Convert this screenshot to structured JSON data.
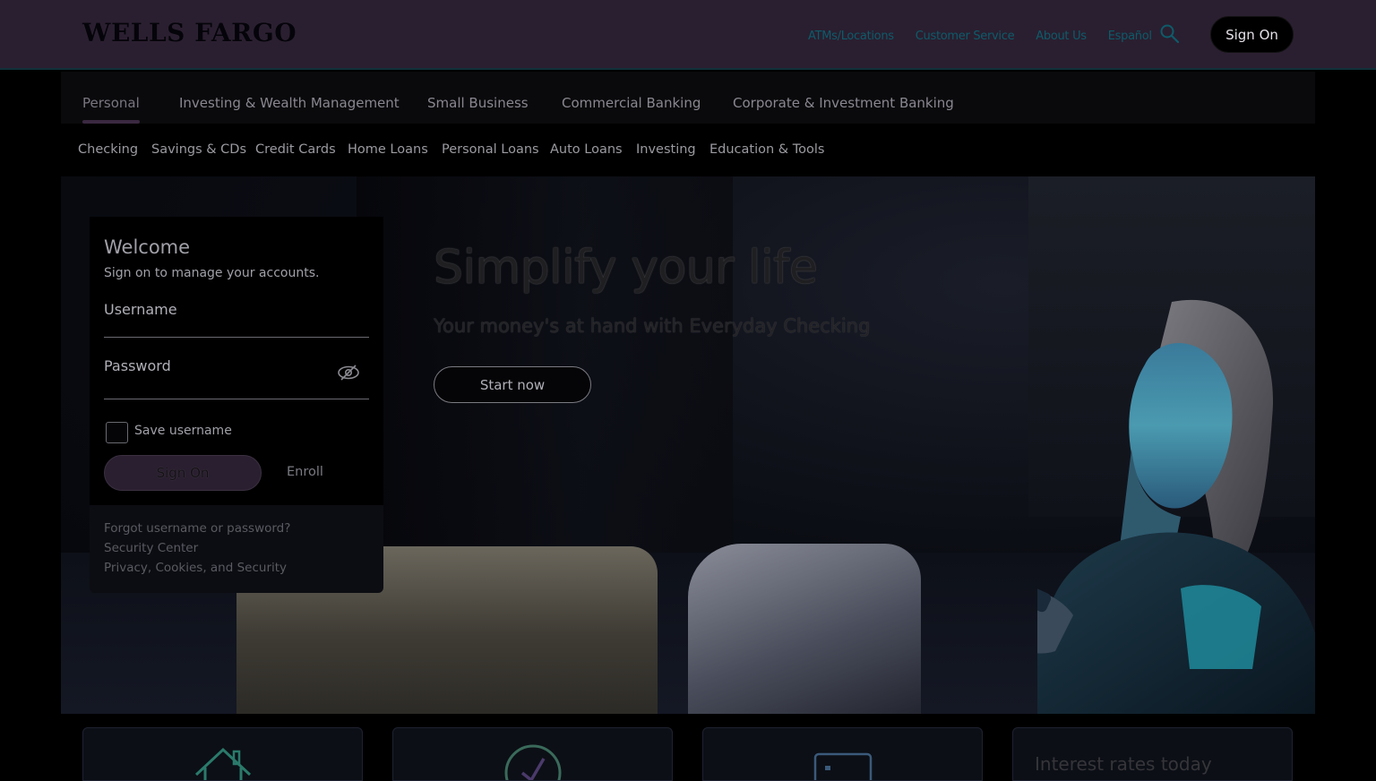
{
  "header": {
    "logo": "WELLS FARGO",
    "links": [
      "ATMs/Locations",
      "Customer Service",
      "About Us",
      "Español"
    ],
    "sign_on": "Sign On",
    "search_icon": "search-icon"
  },
  "main_nav": {
    "tabs": [
      "Personal",
      "Investing & Wealth Management",
      "Small Business",
      "Commercial Banking",
      "Corporate & Investment Banking"
    ],
    "active": "Personal"
  },
  "sub_nav": {
    "items": [
      "Checking",
      "Savings & CDs",
      "Credit Cards",
      "Home Loans",
      "Personal Loans",
      "Auto Loans",
      "Investing",
      "Education & Tools"
    ]
  },
  "login": {
    "title": "Welcome",
    "subtitle": "Sign on to manage your accounts.",
    "username_label": "Username",
    "password_label": "Password",
    "save_username": "Save username",
    "sign_on": "Sign On",
    "enroll": "Enroll",
    "links": [
      "Forgot username or password?",
      "Security Center",
      "Privacy, Cookies, and Security"
    ]
  },
  "hero": {
    "title": "Simplify your life",
    "subtitle": "Your money's at hand with Everyday Checking",
    "cta": "Start now"
  },
  "cards": {
    "icons": [
      "house-icon",
      "checkmark-circle-icon",
      "card-icon"
    ],
    "rates_title": "Interest rates today"
  }
}
